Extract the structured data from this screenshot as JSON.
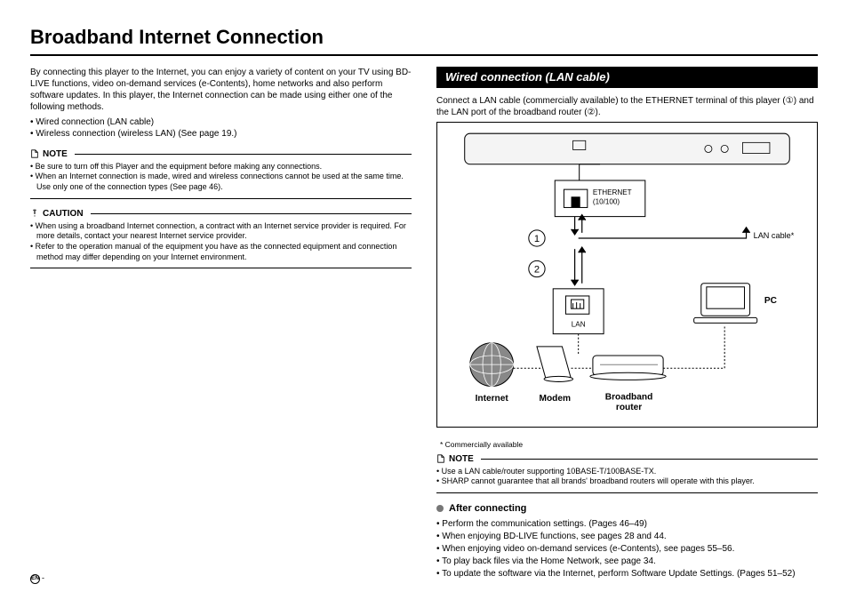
{
  "title": "Broadband Internet Connection",
  "left": {
    "intro": "By connecting this player to the Internet, you can enjoy a variety of content on your TV using BD-LIVE functions, video on-demand services (e-Contents), home networks and also perform software updates. In this player, the Internet connection can be made using either one of the following methods.",
    "methods": [
      "Wired connection (LAN cable)",
      "Wireless connection (wireless LAN) (See page 19.)"
    ],
    "note_label": "NOTE",
    "note_items": [
      "Be sure to turn off this Player and the equipment before making any connections.",
      "When an Internet connection is made, wired and wireless connections cannot be used at the same time. Use only one of the connection types (See page 46)."
    ],
    "caution_label": "CAUTION",
    "caution_items": [
      "When using a broadband Internet connection, a contract with an Internet service provider is required. For more details, contact your nearest Internet service provider.",
      "Refer to the operation manual of the equipment you have as the connected equipment and connection method may differ depending on your Internet environment."
    ]
  },
  "right": {
    "section_title": "Wired connection (LAN cable)",
    "intro": "Connect a LAN cable (commercially available) to the ETHERNET terminal of this player (①) and the LAN port of the broadband router (②).",
    "diagram": {
      "ethernet_label": "ETHERNET (10/100)",
      "marker1": "①",
      "marker2": "②",
      "lan_cable": "LAN cable*",
      "lan_label": "LAN",
      "pc": "PC",
      "internet": "Internet",
      "modem": "Modem",
      "router": "Broadband router"
    },
    "footnote": "*  Commercially available",
    "note_label": "NOTE",
    "note_items": [
      "Use a LAN cable/router supporting 10BASE-T/100BASE-TX.",
      "SHARP cannot guarantee that all brands' broadband routers will operate with this player."
    ],
    "after_label": "After connecting",
    "after_items": [
      "Perform the communication settings. (Pages 46–49)",
      "When enjoying BD-LIVE functions, see pages 28 and 44.",
      "When enjoying video on-demand services (e-Contents), see pages 55–56.",
      "To play back files via the Home Network, see page 34.",
      "To update the software via the Internet, perform Software Update Settings. (Pages 51–52)"
    ]
  },
  "page_lang": "EN",
  "page_sep": "-"
}
